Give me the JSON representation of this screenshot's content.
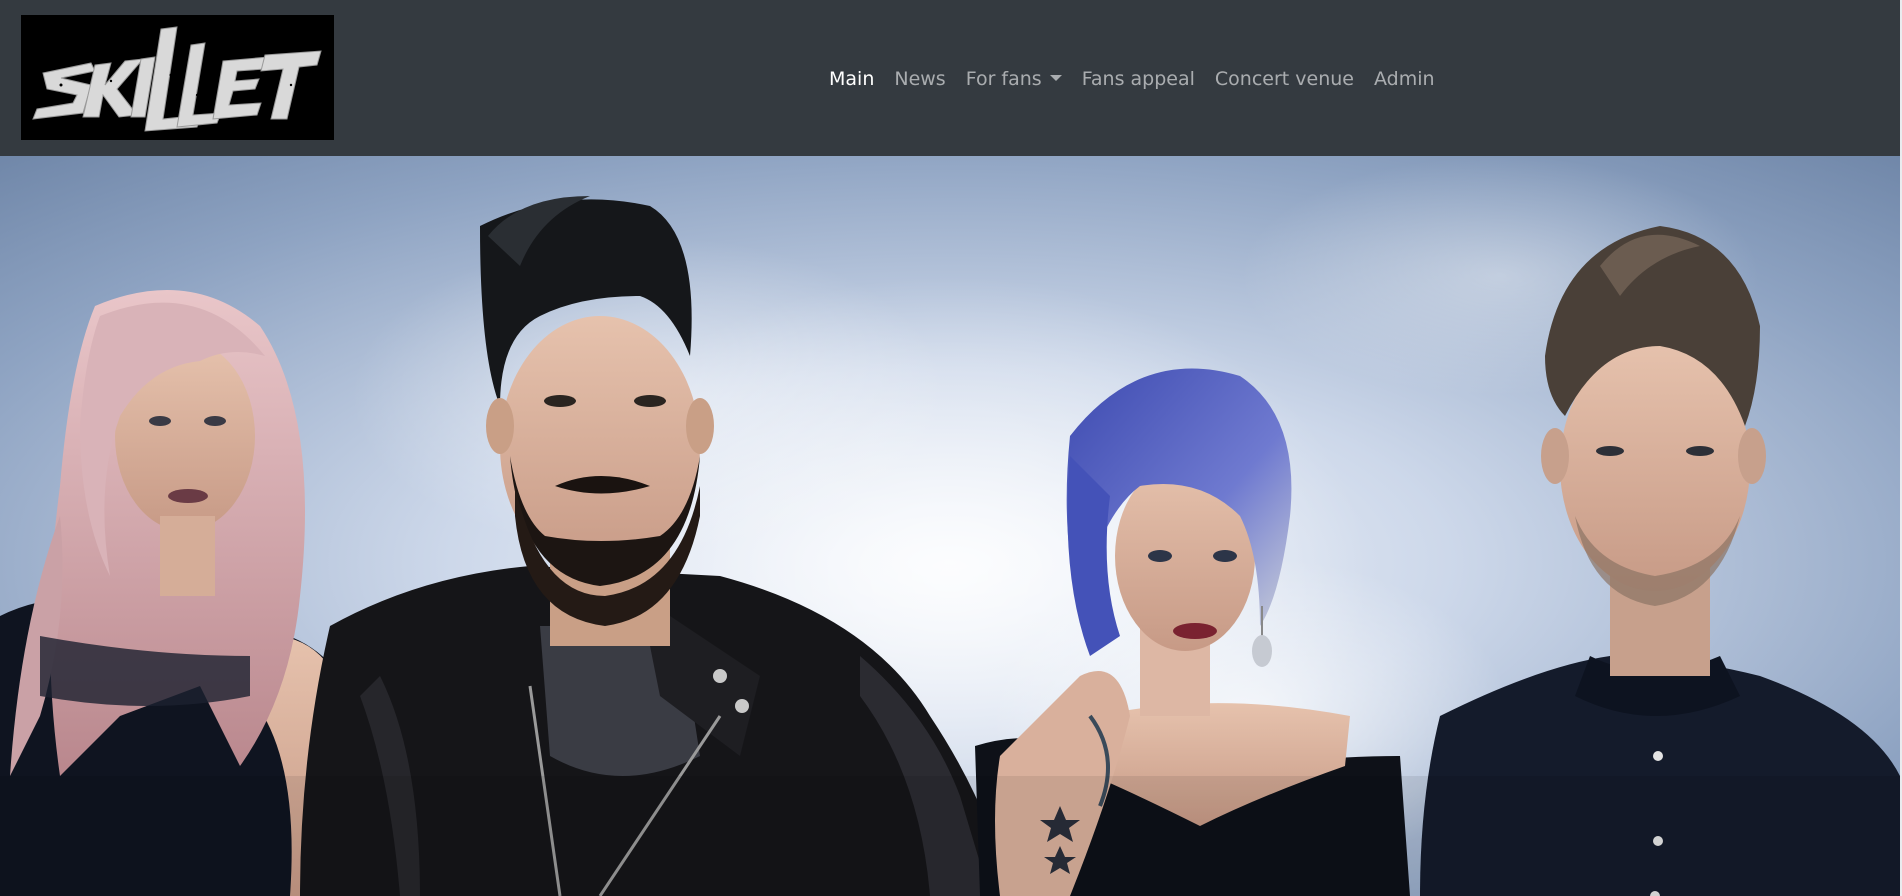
{
  "brand": {
    "logo_text": "SKILLET",
    "logo_icon": "skillet-logo"
  },
  "nav": {
    "items": [
      {
        "label": "Main",
        "active": true
      },
      {
        "label": "News",
        "active": false
      },
      {
        "label": "For fans",
        "active": false,
        "dropdown": true
      },
      {
        "label": "Fans appeal",
        "active": false
      },
      {
        "label": "Concert venue",
        "active": false
      },
      {
        "label": "Admin",
        "active": false
      }
    ]
  },
  "hero": {
    "image": "band-photo",
    "description_icon": "band-members-image"
  },
  "colors": {
    "navbar_bg": "#343a40",
    "nav_active": "#ffffff",
    "nav_inactive": "rgba(255,255,255,0.55)",
    "logo_bg": "#000000"
  }
}
